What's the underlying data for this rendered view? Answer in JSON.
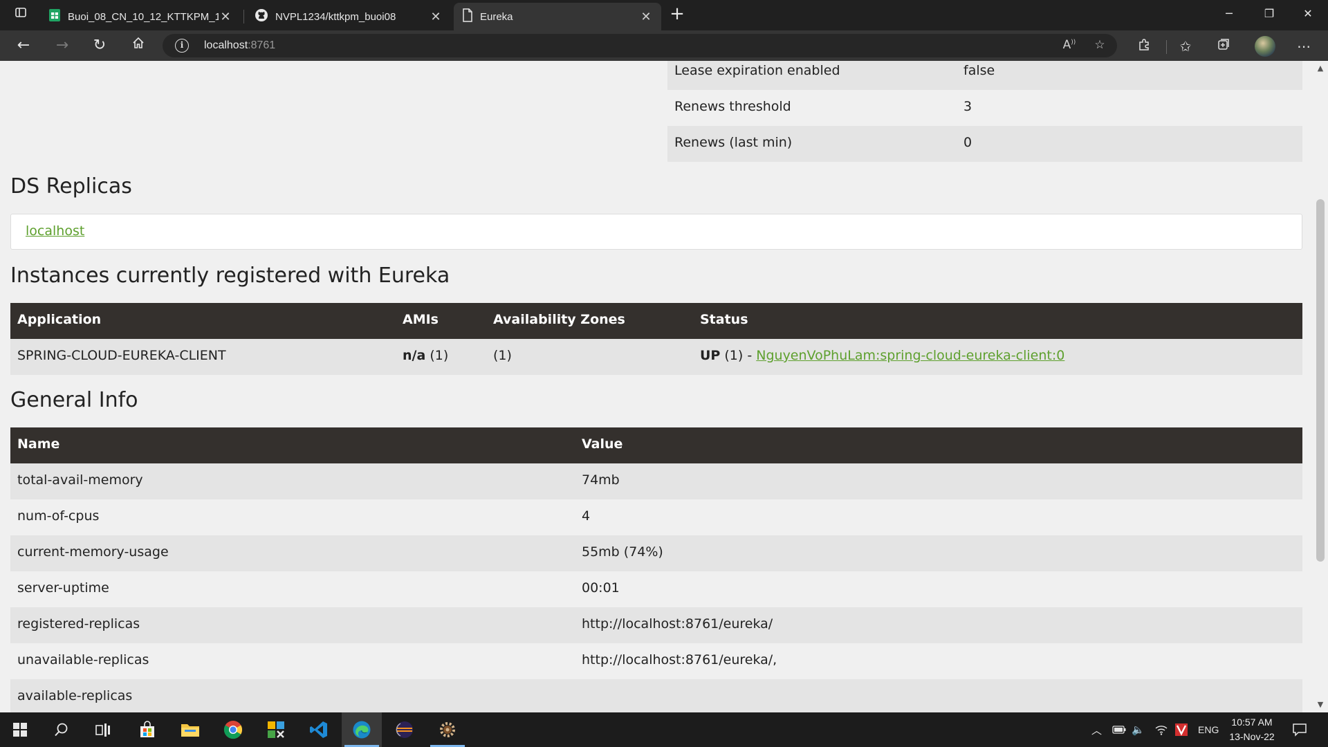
{
  "browser": {
    "tabs": [
      {
        "title": "Buoi_08_CN_10_12_KTTKPM_15A",
        "icon": "sheets-icon",
        "active": false
      },
      {
        "title": "NVPL1234/kttkpm_buoi08",
        "icon": "github-icon",
        "active": false
      },
      {
        "title": "Eureka",
        "icon": "page-icon",
        "active": true
      }
    ],
    "url_host": "localhost",
    "url_port": ":8761"
  },
  "lease_info": [
    {
      "name": "Lease expiration enabled",
      "value": "false"
    },
    {
      "name": "Renews threshold",
      "value": "3"
    },
    {
      "name": "Renews (last min)",
      "value": "0"
    }
  ],
  "ds_replicas": {
    "title": "DS Replicas",
    "link": "localhost"
  },
  "instances": {
    "title": "Instances currently registered with Eureka",
    "headers": [
      "Application",
      "AMIs",
      "Availability Zones",
      "Status"
    ],
    "rows": [
      {
        "application": "SPRING-CLOUD-EUREKA-CLIENT",
        "amis_bold": "n/a",
        "amis_count": " (1)",
        "zones": "(1)",
        "status_bold": "UP",
        "status_count": " (1) - ",
        "status_link": "NguyenVoPhuLam:spring-cloud-eureka-client:0"
      }
    ]
  },
  "general_info": {
    "title": "General Info",
    "headers": [
      "Name",
      "Value"
    ],
    "rows": [
      {
        "name": "total-avail-memory",
        "value": "74mb"
      },
      {
        "name": "num-of-cpus",
        "value": "4"
      },
      {
        "name": "current-memory-usage",
        "value": "55mb (74%)"
      },
      {
        "name": "server-uptime",
        "value": "00:01"
      },
      {
        "name": "registered-replicas",
        "value": "http://localhost:8761/eureka/"
      },
      {
        "name": "unavailable-replicas",
        "value": "http://localhost:8761/eureka/,"
      },
      {
        "name": "available-replicas",
        "value": ""
      }
    ]
  },
  "taskbar": {
    "apps": [
      "start-icon",
      "search-icon",
      "task-view-icon",
      "store-icon",
      "file-explorer-icon",
      "chrome-icon",
      "app-icon",
      "vscode-icon",
      "edge-icon",
      "eclipse-icon",
      "settings-gear-icon"
    ],
    "language": "ENG",
    "time": "10:57 AM",
    "date": "13-Nov-22"
  }
}
